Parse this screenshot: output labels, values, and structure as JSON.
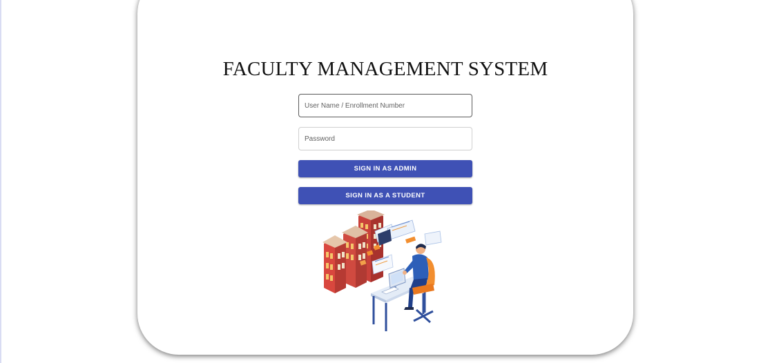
{
  "app": {
    "title": "FACULTY MANAGEMENT SYSTEM"
  },
  "login": {
    "username_placeholder": "User Name / Enrollment Number",
    "username_value": "",
    "password_placeholder": "Password",
    "password_value": "",
    "admin_button_label": "SIGN IN AS ADMIN",
    "student_button_label": "SIGN IN AS A STUDENT"
  },
  "colors": {
    "button_bg": "#3f51b5",
    "button_text": "#ffffff",
    "title_text": "#111111"
  },
  "illustration": {
    "icon": "campus-building-and-person-at-computer-illustration"
  }
}
